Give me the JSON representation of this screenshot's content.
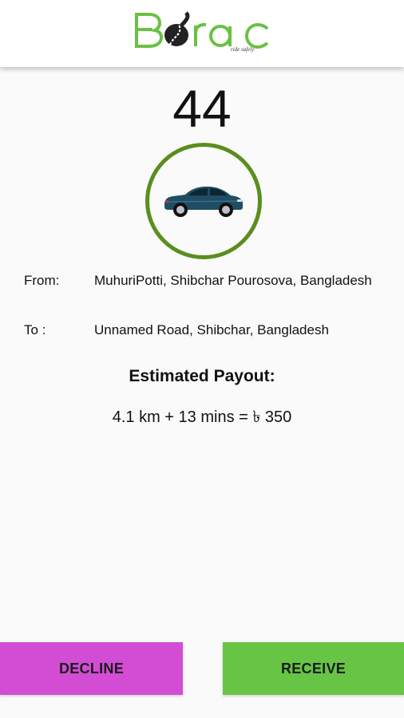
{
  "header": {
    "logo_text": "BORAC",
    "tagline": "ride safely",
    "brand_color": "#6ac142"
  },
  "timer": {
    "value": "44"
  },
  "vehicle": {
    "icon": "car-icon",
    "ring_color": "#5a8e1e"
  },
  "trip": {
    "from_label": "From:",
    "from_value": "MuhuriPotti, Shibchar Pourosova, Bangladesh",
    "to_label": "To :",
    "to_value": "Unnamed Road, Shibchar, Bangladesh"
  },
  "payout": {
    "title": "Estimated Payout:",
    "value": "4.1 km + 13 mins = ৳ 350"
  },
  "actions": {
    "decline_label": "DECLINE",
    "decline_color": "#d24dd4",
    "receive_label": "RECEIVE",
    "receive_color": "#67c445"
  }
}
